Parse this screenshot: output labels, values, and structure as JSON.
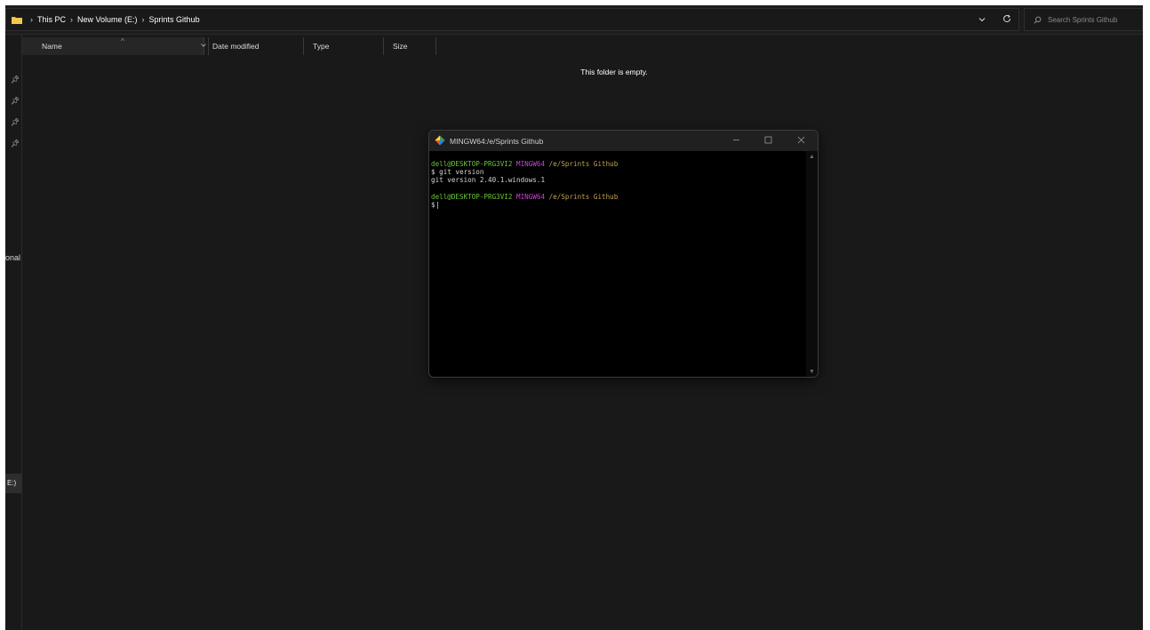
{
  "address": {
    "breadcrumbs": [
      "This PC",
      "New Volume (E:)",
      "Sprints Github"
    ],
    "separator": "›",
    "search_placeholder": "Search Sprints Github"
  },
  "columns": {
    "name": "Name",
    "date_modified": "Date modified",
    "type": "Type",
    "size": "Size"
  },
  "empty_message": "This folder is empty.",
  "nav_fragments": {
    "personal": "onal",
    "drive": "E:)"
  },
  "terminal": {
    "title": "MINGW64:/e/Sprints Github",
    "prompt_user": "dell@DESKTOP-PRG3VI2",
    "prompt_env": "MINGW64",
    "prompt_path": "/e/Sprints Github",
    "cmd1": "$ git version",
    "out1": "git version 2.40.1.windows.1",
    "prompt_symbol": "$"
  },
  "colors": {
    "prompt_user": "#6cc53a",
    "prompt_env": "#c745d4",
    "prompt_path": "#c2a24e",
    "background": "#191919"
  }
}
